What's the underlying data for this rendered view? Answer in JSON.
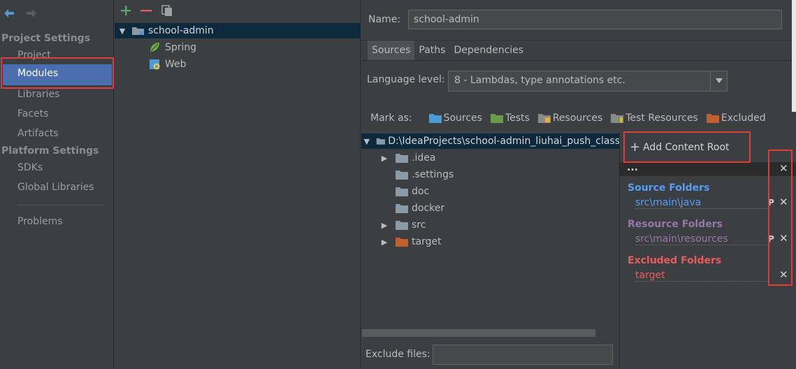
{
  "nav": {
    "sections": [
      {
        "title": "Project Settings",
        "items": [
          "Project",
          "Modules",
          "Libraries",
          "Facets",
          "Artifacts"
        ]
      },
      {
        "title": "Platform Settings",
        "items": [
          "SDKs",
          "Global Libraries"
        ]
      }
    ],
    "problems": "Problems",
    "selected": "Modules"
  },
  "modules": {
    "root": "school-admin",
    "children": [
      "Spring",
      "Web"
    ]
  },
  "name_label": "Name:",
  "name_value": "school-admin",
  "tabs": [
    "Sources",
    "Paths",
    "Dependencies"
  ],
  "language": {
    "label": "Language level:",
    "value": "8 - Lambdas, type annotations etc."
  },
  "mark_as": {
    "label": "Mark as:",
    "items": [
      {
        "label": "Sources",
        "color": "#4d9bd3"
      },
      {
        "label": "Tests",
        "color": "#6a9a4a"
      },
      {
        "label": "Resources",
        "color": "#8a8a8a"
      },
      {
        "label": "Test Resources",
        "color": "#8a8a8a"
      },
      {
        "label": "Excluded",
        "color": "#c06030"
      }
    ]
  },
  "content_tree": {
    "root": "D:\\IdeaProjects\\school-admin_liuhai_push_class",
    "children": [
      ".idea",
      ".settings",
      "doc",
      "docker",
      "src",
      "target"
    ]
  },
  "roots_panel": {
    "add_label": "Add Content Root",
    "header": "...",
    "source": {
      "title": "Source Folders",
      "path": "src\\main\\java",
      "color": "#589df6"
    },
    "resource": {
      "title": "Resource Folders",
      "path": "src\\main\\resources",
      "color": "#9876aa"
    },
    "excluded": {
      "title": "Excluded Folders",
      "path": "target",
      "color": "#e85c5c"
    }
  },
  "exclude_label": "Exclude files:",
  "icons": {
    "back": "back-arrow-icon",
    "forward": "forward-arrow-icon",
    "add": "plus-icon",
    "remove": "minus-icon",
    "copy": "copy-icon"
  },
  "colors": {
    "selection": "#4b6eaf",
    "tree_selection": "#0d293e",
    "highlight": "#e03a3a"
  }
}
